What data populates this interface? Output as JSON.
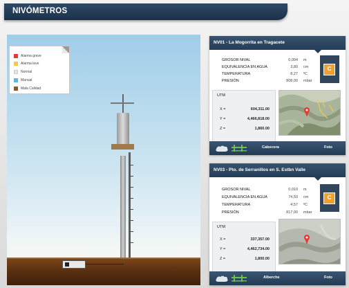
{
  "page_title": "NIVÓMETROS",
  "legend": [
    {
      "label": "Alarma grave",
      "color": "#e53935"
    },
    {
      "label": "Alarma leve",
      "color": "#f2c94c"
    },
    {
      "label": "Normal",
      "color": "#e6e6e6"
    },
    {
      "label": "Manual",
      "color": "#5bb7e0"
    },
    {
      "label": "Mala Calidad",
      "color": "#8b5a2b"
    }
  ],
  "stations": [
    {
      "title": "NV01 - La Mogorrita en Tragacete",
      "measurements": [
        {
          "label": "GROSOR NIVAL",
          "value": "0,004",
          "unit": "m"
        },
        {
          "label": "EQUIVALENCIA EN AGUA",
          "value": "3,80",
          "unit": "cm"
        },
        {
          "label": "TEMPERATURA",
          "value": "8,27",
          "unit": "ºC"
        },
        {
          "label": "PRESIÓN",
          "value": "808,00",
          "unit": "mbar"
        }
      ],
      "badge": "C",
      "utm_title": "UTM",
      "coords": [
        {
          "label": "X =",
          "value": "604,311.00"
        },
        {
          "label": "Y =",
          "value": "4,466,818.00"
        },
        {
          "label": "Z =",
          "value": "1,860.00"
        }
      ],
      "footer_left": "Cabecera",
      "footer_right": "Foto"
    },
    {
      "title": "NV03 - Pto. de Serranillos en S. Estbn Valle",
      "measurements": [
        {
          "label": "GROSOR NIVAL",
          "value": "0,010",
          "unit": "m"
        },
        {
          "label": "EQUIVALENCIA EN AGUA",
          "value": "74,50",
          "unit": "cm"
        },
        {
          "label": "TEMPERATURA",
          "value": "4,57",
          "unit": "ºC"
        },
        {
          "label": "PRESIÓN",
          "value": "817,00",
          "unit": "mbar"
        }
      ],
      "badge": "C",
      "utm_title": "UTM",
      "coords": [
        {
          "label": "X =",
          "value": "337,357.00"
        },
        {
          "label": "Y =",
          "value": "4,462,734.00"
        },
        {
          "label": "Z =",
          "value": "1,800.00"
        }
      ],
      "footer_left": "Alberche",
      "footer_right": "Foto"
    }
  ]
}
